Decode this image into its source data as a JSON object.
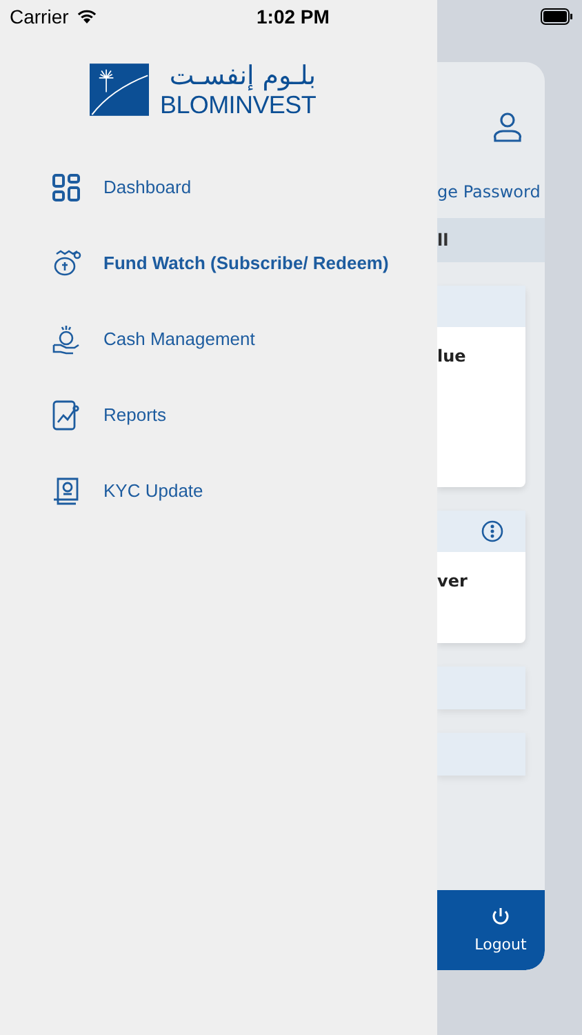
{
  "status_bar": {
    "carrier": "Carrier",
    "time": "1:02 PM"
  },
  "logo": {
    "arabic": "بلـوم إنفسـت",
    "latin": "BLOMINVEST"
  },
  "menu": [
    {
      "label": "Dashboard",
      "kind": "grid",
      "selected": false
    },
    {
      "label": "Fund Watch (Subscribe/ Redeem)",
      "kind": "fund",
      "selected": true
    },
    {
      "label": "Cash Management",
      "kind": "cash",
      "selected": false
    },
    {
      "label": "Reports",
      "kind": "report",
      "selected": false
    },
    {
      "label": "KYC Update",
      "kind": "kyc",
      "selected": false
    }
  ],
  "background_screen": {
    "link": "ge Password",
    "section": "ll",
    "cards": [
      {
        "title": "lue",
        "info": false
      },
      {
        "title": "ver",
        "info": true
      }
    ],
    "logout": "Logout"
  }
}
